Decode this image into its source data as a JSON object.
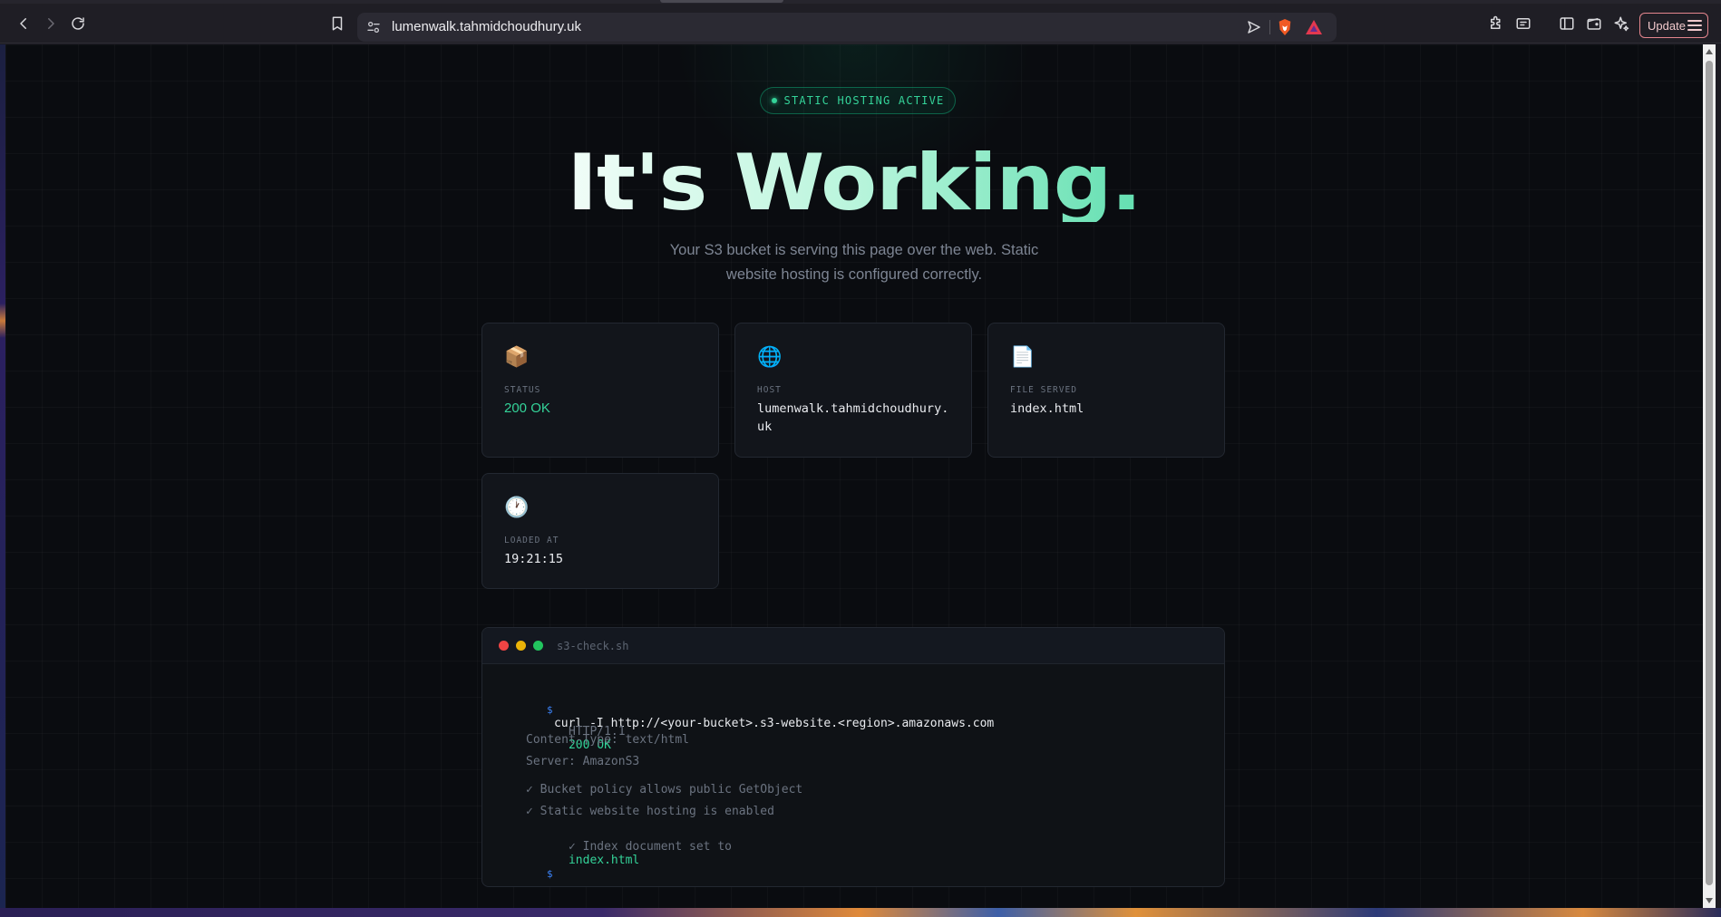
{
  "browser": {
    "url": "lumenwalk.tahmidchoudhury.uk",
    "update_label": "Update"
  },
  "page": {
    "badge": "STATIC HOSTING ACTIVE",
    "headline": "It's Working.",
    "subtitle": "Your S3 bucket is serving this page over the web. Static website hosting is configured correctly.",
    "cards": [
      {
        "icon": "📦",
        "icon_name": "package-icon",
        "label": "STATUS",
        "value": "200 OK"
      },
      {
        "icon": "🌐",
        "icon_name": "globe-icon",
        "label": "HOST",
        "value": "lumenwalk.tahmidchoudhury.uk"
      },
      {
        "icon": "📄",
        "icon_name": "document-icon",
        "label": "FILE SERVED",
        "value": "index.html"
      },
      {
        "icon": "🕐",
        "icon_name": "clock-icon",
        "label": "LOADED AT",
        "value": "19:21:15"
      }
    ],
    "terminal": {
      "title": "s3-check.sh",
      "prompt": "$",
      "command": "curl -I http://<your-bucket>.s3-website.<region>.amazonaws.com",
      "http_version": "HTTP/1.1",
      "http_status": "200 OK",
      "content_type": "Content-Type: text/html",
      "server": "Server: AmazonS3",
      "check_1": "✓ Bucket policy allows public GetObject",
      "check_2": "✓ Static website hosting is enabled",
      "check_3_prefix": "✓ Index document set to",
      "check_3_value": "index.html"
    }
  },
  "colors": {
    "accent": "#34d399",
    "background": "#0a0c10",
    "card": "#12151b",
    "prompt": "#3b82f6"
  }
}
